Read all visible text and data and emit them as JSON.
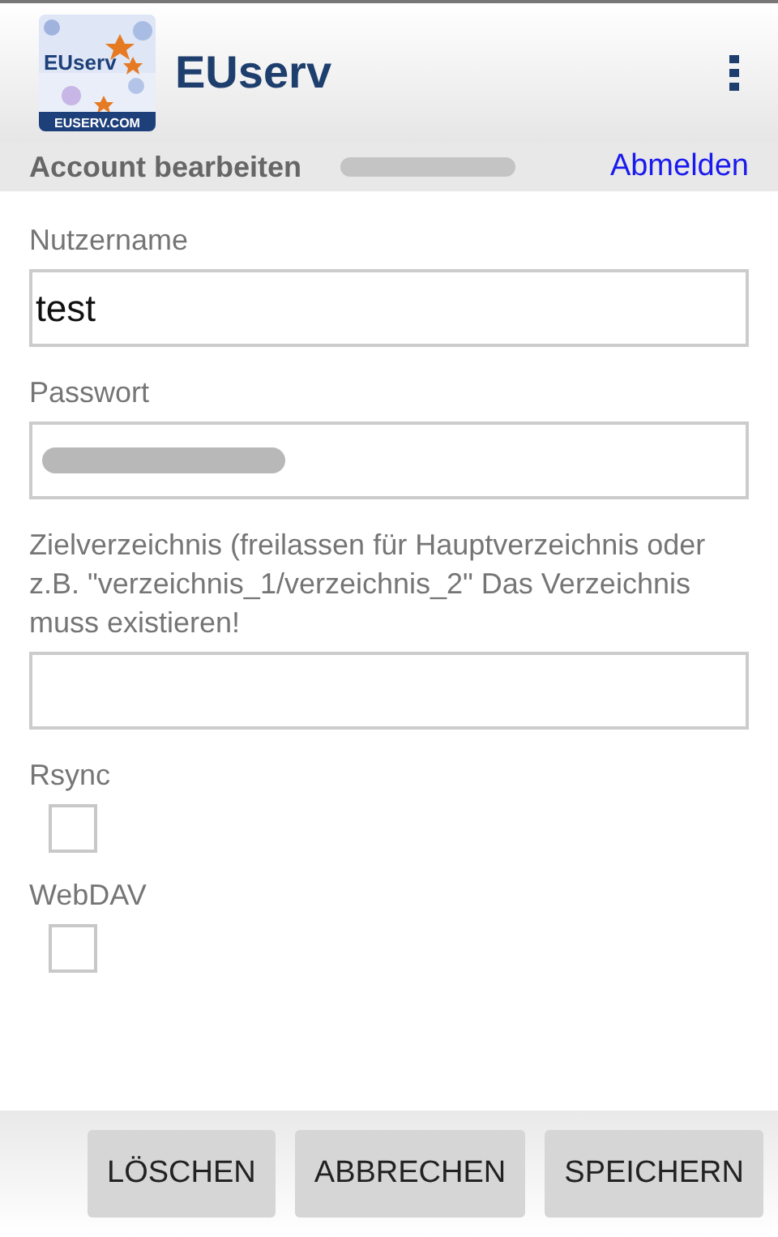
{
  "app_bar": {
    "logo": {
      "wordmark": "EUserv",
      "domain": "EUSERV.COM"
    },
    "title": "EUserv"
  },
  "sub_bar": {
    "title": "Account bearbeiten",
    "account_redacted": true,
    "logout_link": "Abmelden"
  },
  "fields": [
    {
      "kind": "text",
      "label": "Nutzername",
      "value": "test"
    },
    {
      "kind": "text",
      "label": "Passwort",
      "redacted": true
    },
    {
      "kind": "text",
      "label": "Zielverzeichnis (freilassen für Hauptverzeichnis oder z.B. \"verzeichnis_1/verzeichnis_2\" Das Verzeichnis muss existieren!"
    },
    {
      "kind": "checkbox",
      "label": "Rsync",
      "checked": false
    },
    {
      "kind": "checkbox",
      "label": "WebDAV",
      "checked": false
    }
  ],
  "buttons": [
    "LÖSCHEN",
    "ABBRECHEN",
    "SPEICHERN"
  ]
}
